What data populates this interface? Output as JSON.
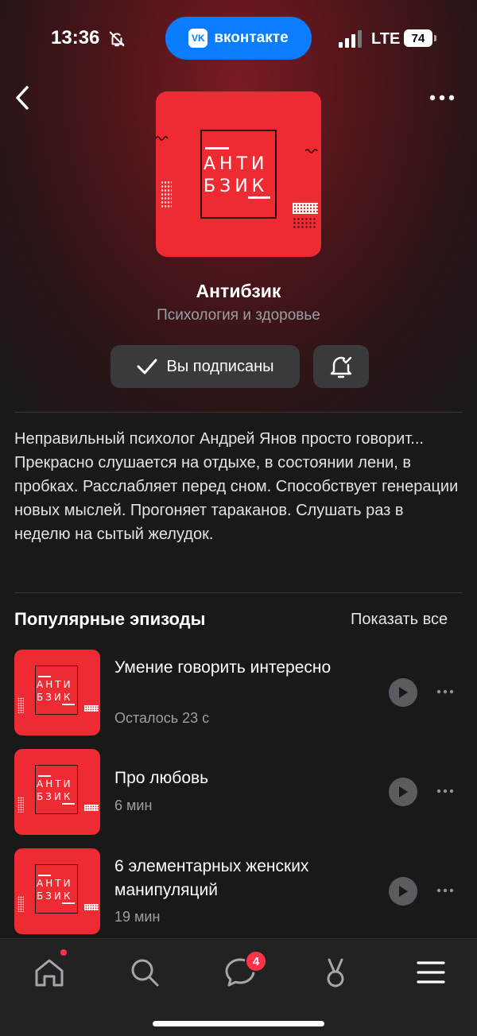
{
  "status_bar": {
    "time": "13:36",
    "carrier_pill": "вконтакте",
    "network": "LTE",
    "battery": "74"
  },
  "podcast": {
    "cover_text_line1": "АНТИ",
    "cover_text_line2": "БЗИК",
    "title": "Антибзик",
    "category": "Психология и здоровье",
    "subscribed_label": "Вы подписаны",
    "description": "Неправильный психолог Андрей Янов просто говорит... Прекрасно слушается на отдыхе, в состоянии лени, в пробках. Расслабляет перед сном. Способствует генерации новых мыслей. Прогоняет тараканов. Слушать раз в неделю на сытый желудок."
  },
  "popular": {
    "title": "Популярные эпизоды",
    "show_all": "Показать все",
    "episodes": [
      {
        "title": "Умение говорить интересно",
        "meta": "Осталось 23 с",
        "thumb_line1": "АНТИ",
        "thumb_line2": "БЗИК"
      },
      {
        "title": "Про любовь",
        "meta": "6 мин",
        "thumb_line1": "АНТИ",
        "thumb_line2": "БЗИК"
      },
      {
        "title": "6 элементарных женских манипуляций",
        "meta": "19 мин",
        "thumb_line1": "АНТИ",
        "thumb_line2": "БЗИК"
      }
    ]
  },
  "tabbar": {
    "messages_badge": "4",
    "tabs": [
      "home-icon",
      "search-icon",
      "messages-icon",
      "clips-icon",
      "menu-icon"
    ]
  },
  "colors": {
    "accent_red": "#ee2b33",
    "vk_blue": "#0a7cff",
    "badge_red": "#ff3347"
  }
}
